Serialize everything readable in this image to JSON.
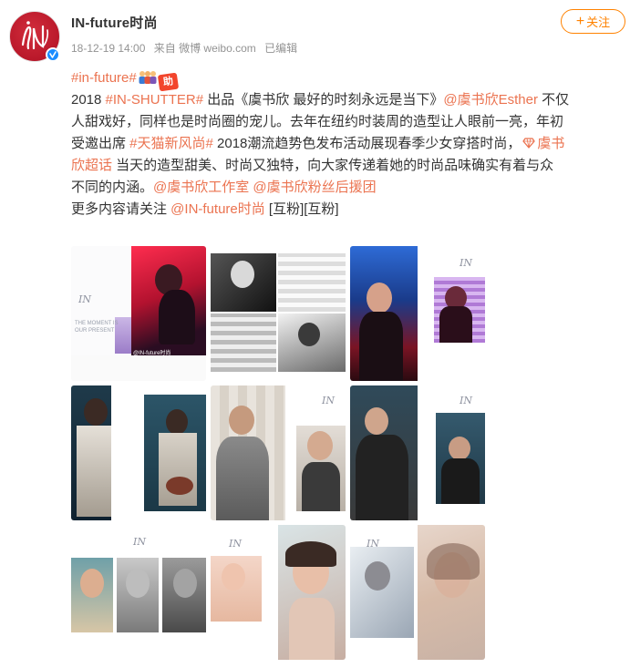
{
  "post": {
    "author": {
      "name": "IN-future时尚",
      "avatar_letters": "IN",
      "verified_icon": "verified-badge-icon"
    },
    "meta": {
      "time": "18-12-19 14:00",
      "source": "来自 微博 weibo.com",
      "edited": "已编辑"
    },
    "follow_label": "关注",
    "text": {
      "l1_tag": "#in-future#",
      "l1_emoji_label": "助",
      "l2_a": "2018 ",
      "l2_tag": "#IN-SHUTTER#",
      "l2_b": " 出品《虞书欣 最好的时刻永远是当下》",
      "l2_mention": "@虞书欣Esther",
      "l2_c": " 不仅",
      "l3": "人甜戏好，同样也是时尚圈的宠儿。去年在纽约时装周的造型让人眼前一亮，年初",
      "l4_a": "受邀出席 ",
      "l4_tag": "#天猫新风尚#",
      "l4_b": " 2018潮流趋势色发布活动展现春季少女穿搭时尚，",
      "l4_link": "虞书",
      "l5_link": "欣超话",
      "l5_b": " 当天的造型甜美、时尚又独特，向大家传递着她的时尚品味确实有着与众",
      "l6_a": "不同的内涵。",
      "l6_m1": "@虞书欣工作室",
      "l6_m2": "@虞书欣粉丝后援团",
      "l7_a": "更多内容请关注 ",
      "l7_mention": "@IN-future时尚",
      "l7_b": " [互粉][互粉]"
    },
    "images": {
      "watermark": "@IN-future时尚",
      "cover_caption_1": "THE MOMENT IS",
      "cover_caption_2": "OUR PRESENT",
      "logo_mark": "IN"
    },
    "colors": {
      "link": "#eb7350",
      "follow": "#ff8200",
      "verified": "#1a8cff",
      "avatar": "#c21d2d"
    }
  }
}
